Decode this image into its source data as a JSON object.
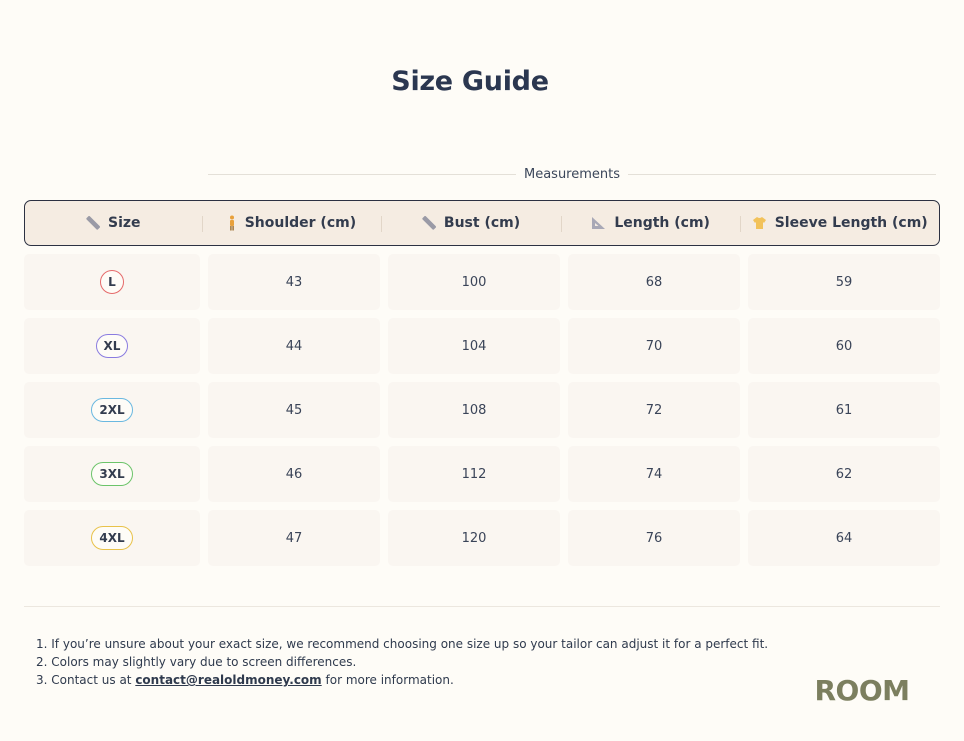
{
  "page": {
    "title": "Size Guide"
  },
  "table": {
    "group_label": "Measurements",
    "headers": [
      {
        "label": "Size",
        "icon": "ruler-icon"
      },
      {
        "label": "Shoulder (cm)",
        "icon": "person-icon"
      },
      {
        "label": "Bust (cm)",
        "icon": "ruler-icon"
      },
      {
        "label": "Length (cm)",
        "icon": "triangle-ruler-icon"
      },
      {
        "label": "Sleeve Length (cm)",
        "icon": "shirt-icon"
      }
    ],
    "rows": [
      {
        "size": "L",
        "color": "#e56a6a",
        "shoulder": "43",
        "bust": "100",
        "length": "68",
        "sleeve": "59"
      },
      {
        "size": "XL",
        "color": "#8a7ce0",
        "shoulder": "44",
        "bust": "104",
        "length": "70",
        "sleeve": "60"
      },
      {
        "size": "2XL",
        "color": "#6ab8e0",
        "shoulder": "45",
        "bust": "108",
        "length": "72",
        "sleeve": "61"
      },
      {
        "size": "3XL",
        "color": "#6cc46a",
        "shoulder": "46",
        "bust": "112",
        "length": "74",
        "sleeve": "62"
      },
      {
        "size": "4XL",
        "color": "#e8c24a",
        "shoulder": "47",
        "bust": "120",
        "length": "76",
        "sleeve": "64"
      }
    ]
  },
  "notes": {
    "n1": "1. If you’re unsure about your exact size, we recommend choosing one size up so your tailor can adjust it for a perfect fit.",
    "n2": "2. Colors may slightly vary due to screen differences.",
    "n3_prefix": "3. Contact us at ",
    "n3_email": "contact@realoldmoney.com",
    "n3_suffix": " for more information."
  },
  "logo": {
    "text": "ROOM",
    "color": "#7c7f5f"
  },
  "colors": {
    "background": "#fefcf7",
    "header_bg": "#f5ece2",
    "cell_bg": "#faf6f1"
  }
}
